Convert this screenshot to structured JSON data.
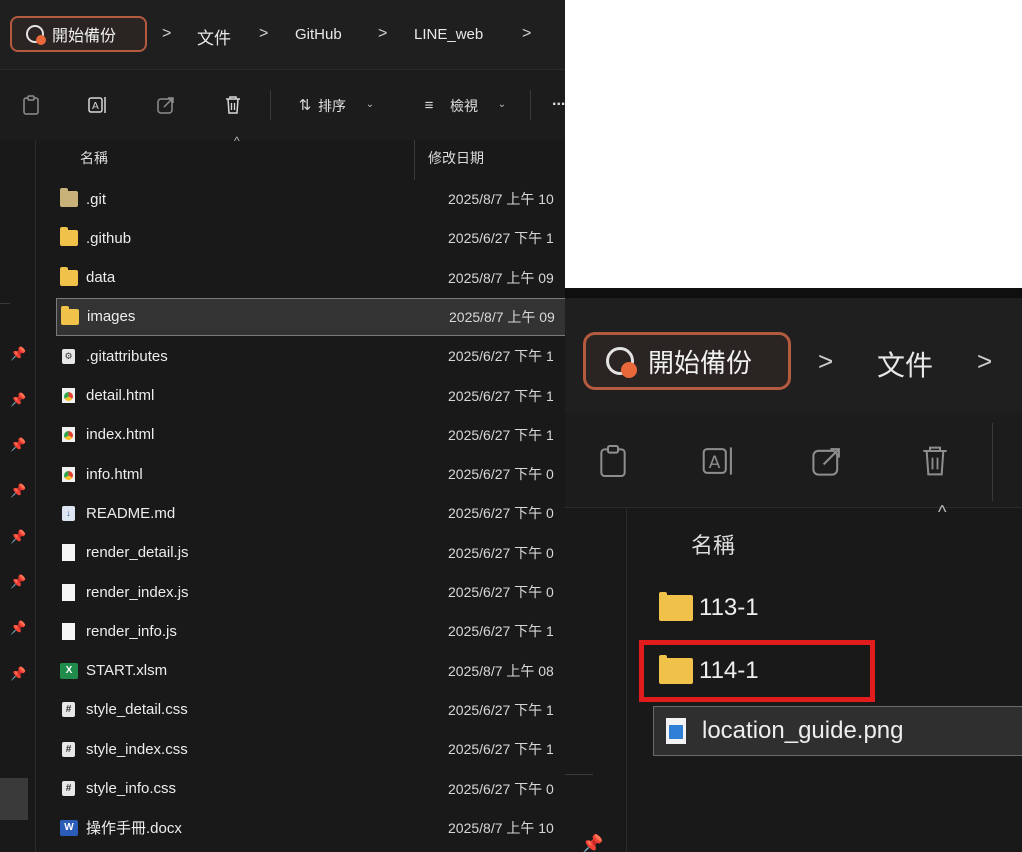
{
  "breadcrumb": {
    "root_label": "開始備份",
    "separator": ">",
    "items": [
      "文件",
      "GitHub",
      "LINE_web"
    ]
  },
  "toolbar": {
    "sort_label": "排序",
    "view_label": "檢視",
    "more_label": "..."
  },
  "columns": {
    "name": "名稱",
    "modified": "修改日期"
  },
  "files": [
    {
      "name": ".git",
      "date": "2025/8/7 上午 10",
      "icon": "folder-icon"
    },
    {
      "name": ".github",
      "date": "2025/6/27 下午 1",
      "icon": "folder-icon"
    },
    {
      "name": "data",
      "date": "2025/8/7 上午 09",
      "icon": "folder-icon"
    },
    {
      "name": "images",
      "date": "2025/8/7 上午 09",
      "icon": "folder-icon"
    },
    {
      "name": ".gitattributes",
      "date": "2025/6/27 下午 1",
      "icon": "settings-file-icon"
    },
    {
      "name": "detail.html",
      "date": "2025/6/27 下午 1",
      "icon": "chrome-html-icon"
    },
    {
      "name": "index.html",
      "date": "2025/6/27 下午 1",
      "icon": "chrome-html-icon"
    },
    {
      "name": "info.html",
      "date": "2025/6/27 下午 0",
      "icon": "chrome-html-icon"
    },
    {
      "name": "README.md",
      "date": "2025/6/27 下午 0",
      "icon": "markdown-file-icon"
    },
    {
      "name": "render_detail.js",
      "date": "2025/6/27 下午 0",
      "icon": "file-icon"
    },
    {
      "name": "render_index.js",
      "date": "2025/6/27 下午 0",
      "icon": "file-icon"
    },
    {
      "name": "render_info.js",
      "date": "2025/6/27 下午 1",
      "icon": "file-icon"
    },
    {
      "name": "START.xlsm",
      "date": "2025/8/7 上午 08",
      "icon": "excel-icon"
    },
    {
      "name": "style_detail.css",
      "date": "2025/6/27 下午 1",
      "icon": "css-file-icon"
    },
    {
      "name": "style_index.css",
      "date": "2025/6/27 下午 1",
      "icon": "css-file-icon"
    },
    {
      "name": "style_info.css",
      "date": "2025/6/27 下午 0",
      "icon": "css-file-icon"
    },
    {
      "name": "操作手冊.docx",
      "date": "2025/8/7 上午 10",
      "icon": "word-icon"
    }
  ],
  "zoom": {
    "breadcrumb_root": "開始備份",
    "breadcrumb_item": "文件",
    "column_name": "名稱",
    "items": [
      {
        "name": "113-1",
        "icon": "folder-icon"
      },
      {
        "name": "114-1",
        "icon": "folder-icon"
      },
      {
        "name": "location_guide.png",
        "icon": "image-file-icon"
      }
    ]
  },
  "colors": {
    "background": "#191919",
    "folder": "#f0c24a",
    "highlight_box": "#e11c1c",
    "backup_pill_border": "#b35a3f"
  }
}
